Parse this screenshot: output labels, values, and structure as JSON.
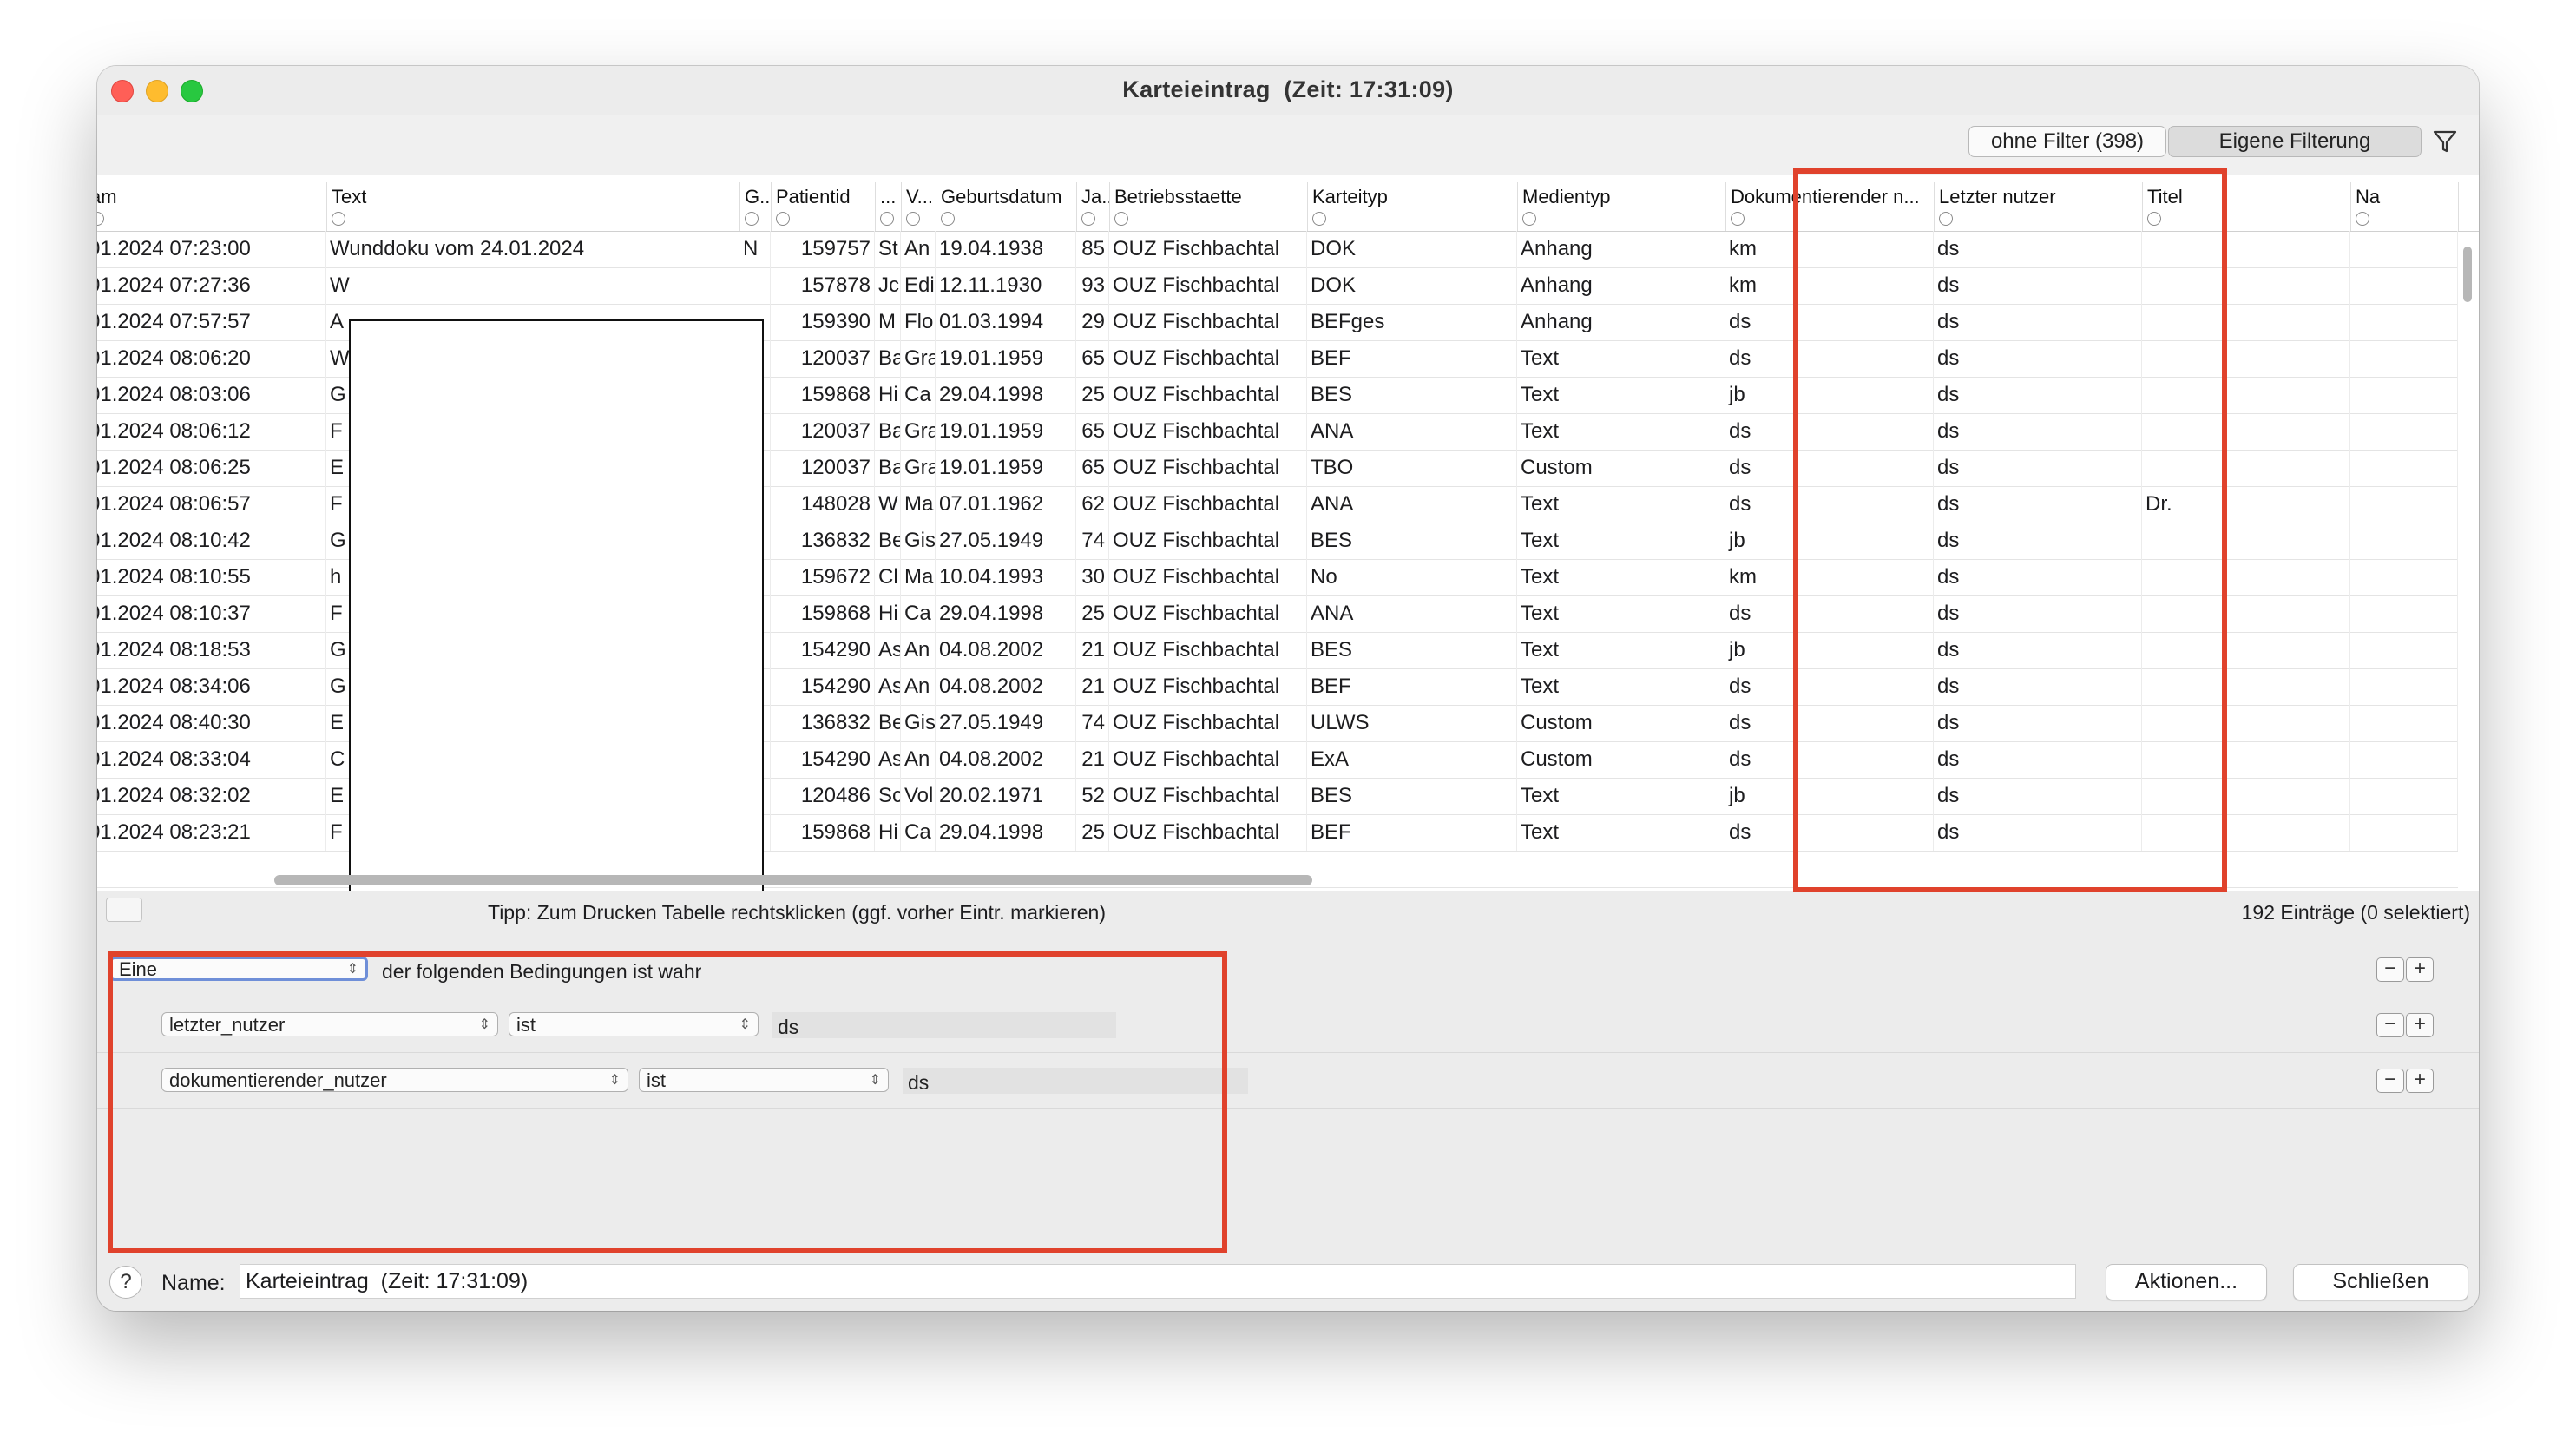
{
  "window": {
    "title": "Karteieintrag  (Zeit: 17:31:09)"
  },
  "toolbar": {
    "filter_all_label": "ohne Filter (398)",
    "filter_own_label": "Eigene Filterung",
    "funnel_icon": "funnel-icon"
  },
  "table": {
    "columns": [
      "am",
      "Text",
      "G...",
      "Patientid",
      "...",
      "V...",
      "Geburtsdatum",
      "Ja...",
      "Betriebsstaette",
      "Karteityp",
      "Medientyp",
      "Dokumentierender n...",
      "Letzter nutzer",
      "Titel",
      "Na"
    ],
    "rows": [
      [
        "01.2024 07:23:00",
        "Wunddoku vom 24.01.2024",
        "N",
        "159757",
        "St",
        "An",
        "19.04.1938",
        "85",
        "OUZ Fischbachtal",
        "DOK",
        "Anhang",
        "km",
        "ds",
        "",
        ""
      ],
      [
        "01.2024 07:27:36",
        "W",
        "",
        "157878",
        "Jc",
        "Edi",
        "12.11.1930",
        "93",
        "OUZ Fischbachtal",
        "DOK",
        "Anhang",
        "km",
        "ds",
        "",
        ""
      ],
      [
        "01.2024 07:57:57",
        "A",
        "",
        "159390",
        "M",
        "Flo",
        "01.03.1994",
        "29",
        "OUZ Fischbachtal",
        "BEFges",
        "Anhang",
        "ds",
        "ds",
        "",
        ""
      ],
      [
        "01.2024 08:06:20",
        "W",
        "",
        "120037",
        "Ba",
        "Gra",
        "19.01.1959",
        "65",
        "OUZ Fischbachtal",
        "BEF",
        "Text",
        "ds",
        "ds",
        "",
        ""
      ],
      [
        "01.2024 08:03:06",
        "G",
        "",
        "159868",
        "Hi",
        "Ca",
        "29.04.1998",
        "25",
        "OUZ Fischbachtal",
        "BES",
        "Text",
        "jb",
        "ds",
        "",
        ""
      ],
      [
        "01.2024 08:06:12",
        "F",
        "",
        "120037",
        "Ba",
        "Gra",
        "19.01.1959",
        "65",
        "OUZ Fischbachtal",
        "ANA",
        "Text",
        "ds",
        "ds",
        "",
        ""
      ],
      [
        "01.2024 08:06:25",
        "E",
        "",
        "120037",
        "Ba",
        "Gra",
        "19.01.1959",
        "65",
        "OUZ Fischbachtal",
        "TBO",
        "Custom",
        "ds",
        "ds",
        "",
        ""
      ],
      [
        "01.2024 08:06:57",
        "F",
        "",
        "148028",
        "W",
        "Ma",
        "07.01.1962",
        "62",
        "OUZ Fischbachtal",
        "ANA",
        "Text",
        "ds",
        "ds",
        "Dr.",
        ""
      ],
      [
        "01.2024 08:10:42",
        "G",
        "",
        "136832",
        "Be",
        "Gis",
        "27.05.1949",
        "74",
        "OUZ Fischbachtal",
        "BES",
        "Text",
        "jb",
        "ds",
        "",
        ""
      ],
      [
        "01.2024 08:10:55",
        "h",
        "",
        "159672",
        "Cl",
        "Ma",
        "10.04.1993",
        "30",
        "OUZ Fischbachtal",
        "No",
        "Text",
        "km",
        "ds",
        "",
        ""
      ],
      [
        "01.2024 08:10:37",
        "F",
        "",
        "159868",
        "Hi",
        "Ca",
        "29.04.1998",
        "25",
        "OUZ Fischbachtal",
        "ANA",
        "Text",
        "ds",
        "ds",
        "",
        ""
      ],
      [
        "01.2024 08:18:53",
        "G",
        "",
        "154290",
        "As",
        "An",
        "04.08.2002",
        "21",
        "OUZ Fischbachtal",
        "BES",
        "Text",
        "jb",
        "ds",
        "",
        ""
      ],
      [
        "01.2024 08:34:06",
        "G",
        "",
        "154290",
        "As",
        "An",
        "04.08.2002",
        "21",
        "OUZ Fischbachtal",
        "BEF",
        "Text",
        "ds",
        "ds",
        "",
        ""
      ],
      [
        "01.2024 08:40:30",
        "E",
        "",
        "136832",
        "Be",
        "Gis",
        "27.05.1949",
        "74",
        "OUZ Fischbachtal",
        "ULWS",
        "Custom",
        "ds",
        "ds",
        "",
        ""
      ],
      [
        "01.2024 08:33:04",
        "C",
        "",
        "154290",
        "As",
        "An",
        "04.08.2002",
        "21",
        "OUZ Fischbachtal",
        "ExA",
        "Custom",
        "ds",
        "ds",
        "",
        ""
      ],
      [
        "01.2024 08:32:02",
        "E",
        "",
        "120486",
        "Sc",
        "Vol",
        "20.02.1971",
        "52",
        "OUZ Fischbachtal",
        "BES",
        "Text",
        "jb",
        "ds",
        "",
        ""
      ],
      [
        "01.2024 08:23:21",
        "F",
        "",
        "159868",
        "Hi",
        "Ca",
        "29.04.1998",
        "25",
        "OUZ Fischbachtal",
        "BEF",
        "Text",
        "ds",
        "ds",
        "",
        ""
      ]
    ]
  },
  "status": {
    "tip": "Tipp: Zum Drucken Tabelle rechtsklicken (ggf. vorher Eintr. markieren)",
    "count": "192 Einträge (0 selektiert)"
  },
  "filters": {
    "match_mode": "Eine",
    "match_text": "der folgenden Bedingungen ist wahr",
    "conditions": [
      {
        "field": "letzter_nutzer",
        "op": "ist",
        "value": "ds"
      },
      {
        "field": "dokumentierender_nutzer",
        "op": "ist",
        "value": "ds"
      }
    ],
    "minus": "−",
    "plus": "+"
  },
  "bottom": {
    "help": "?",
    "name_label": "Name:",
    "name_value": "Karteieintrag  (Zeit: 17:31:09)",
    "actions_label": "Aktionen...",
    "close_label": "Schließen"
  },
  "colors": {
    "highlight": "#e0422c",
    "focus": "#6f8fd8"
  }
}
